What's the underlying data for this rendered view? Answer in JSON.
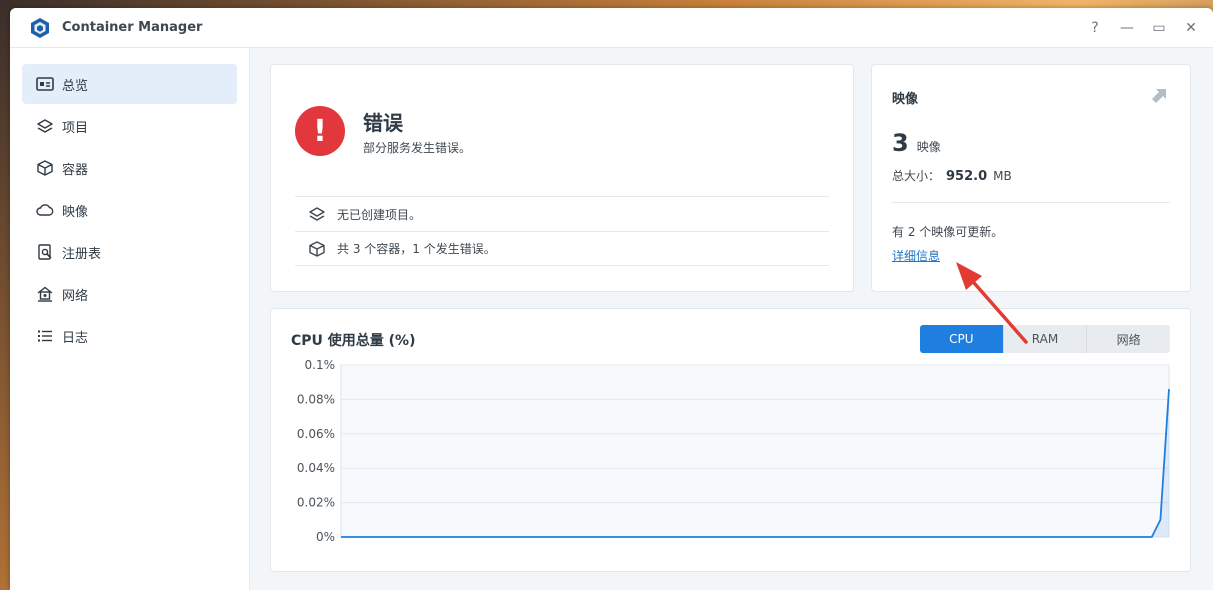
{
  "window": {
    "title": "Container Manager",
    "controls": {
      "help": "?",
      "minimize": "—",
      "maximize": "▭",
      "close": "✕"
    }
  },
  "sidebar": {
    "items": [
      {
        "label": "总览",
        "icon": "overview-icon",
        "active": true
      },
      {
        "label": "项目",
        "icon": "layers-icon",
        "active": false
      },
      {
        "label": "容器",
        "icon": "cube-icon",
        "active": false
      },
      {
        "label": "映像",
        "icon": "cloud-icon",
        "active": false
      },
      {
        "label": "注册表",
        "icon": "registry-search-icon",
        "active": false
      },
      {
        "label": "网络",
        "icon": "network-house-icon",
        "active": false
      },
      {
        "label": "日志",
        "icon": "list-icon",
        "active": false
      }
    ]
  },
  "status": {
    "title": "错误",
    "subtitle": "部分服务发生错误。",
    "rows": [
      {
        "text": "无已创建项目。",
        "icon": "layers-icon"
      },
      {
        "text": "共 3 个容器，1 个发生错误。",
        "icon": "cube-icon"
      }
    ],
    "color": "#e2373d"
  },
  "images": {
    "title": "映像",
    "count": "3",
    "count_unit": "映像",
    "size_label": "总大小：",
    "size_value": "952.0",
    "size_unit": "MB",
    "update_text": "有 2 个映像可更新。",
    "details_link": "详细信息"
  },
  "chart": {
    "title": "CPU 使用总量 (%)",
    "tabs": [
      {
        "label": "CPU",
        "active": true
      },
      {
        "label": "RAM",
        "active": false
      },
      {
        "label": "网络",
        "active": false
      }
    ],
    "accent": "#1e7fe0"
  },
  "chart_data": {
    "type": "area",
    "title": "CPU 使用总量 (%)",
    "ylim": [
      0,
      0.1
    ],
    "y_ticks": [
      "0.1%",
      "0.08%",
      "0.06%",
      "0.04%",
      "0.02%",
      "0%"
    ],
    "grid": true,
    "series": [
      {
        "values": [
          0,
          0,
          0,
          0,
          0,
          0,
          0,
          0,
          0,
          0,
          0,
          0,
          0,
          0,
          0,
          0,
          0,
          0,
          0,
          0,
          0,
          0,
          0,
          0,
          0,
          0,
          0,
          0,
          0,
          0,
          0,
          0,
          0,
          0,
          0,
          0,
          0,
          0,
          0,
          0,
          0,
          0,
          0,
          0,
          0,
          0,
          0,
          0,
          0,
          0,
          0,
          0,
          0,
          0,
          0,
          0,
          0,
          0,
          0,
          0,
          0,
          0,
          0,
          0,
          0,
          0,
          0,
          0,
          0,
          0,
          0,
          0,
          0,
          0,
          0,
          0,
          0,
          0,
          0,
          0,
          0,
          0,
          0,
          0,
          0,
          0,
          0,
          0,
          0,
          0,
          0,
          0,
          0,
          0,
          0,
          0.01,
          0.086
        ]
      }
    ]
  }
}
